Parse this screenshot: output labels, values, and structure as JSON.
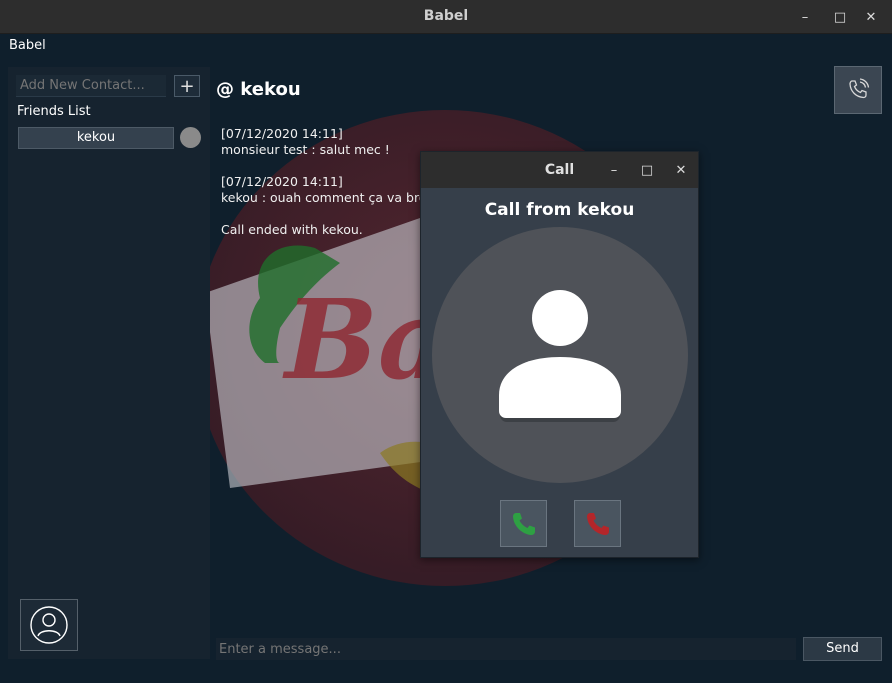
{
  "window": {
    "title": "Babel",
    "minimize_glyph": "–",
    "maximize_glyph": "□",
    "close_glyph": "✕"
  },
  "menubar": {
    "app_menu": "Babel"
  },
  "sidebar": {
    "add_contact_placeholder": "Add New Contact...",
    "add_button_label": "+",
    "friends_label": "Friends List",
    "friends": [
      {
        "name": "kekou",
        "status_color": "#8a8a8a"
      }
    ],
    "profile_icon": "user-circle-icon"
  },
  "chat": {
    "header": "@ kekou",
    "call_icon": "phone-ringing-icon",
    "messages": [
      {
        "timestamp": "[07/12/2020 14:11]",
        "text": "monsieur test : salut mec !"
      },
      {
        "timestamp": "[07/12/2020 14:11]",
        "text": "kekou : ouah comment ça va bro ?"
      }
    ],
    "status_message": "Call ended with kekou.",
    "input_placeholder": "Enter a message...",
    "send_label": "Send"
  },
  "call_dialog": {
    "title": "Call",
    "minimize_glyph": "–",
    "maximize_glyph": "□",
    "close_glyph": "✕",
    "heading": "Call from kekou",
    "avatar_icon": "user-silhouette-icon",
    "accept_icon": "phone-accept-icon",
    "decline_icon": "phone-decline-icon",
    "accept_color": "#2ea043",
    "decline_color": "#b3262a"
  },
  "colors": {
    "background": "#0f1f2c",
    "sidebar": "#16232f",
    "titlebar": "#2d2d2d",
    "dialog": "#363f4a"
  }
}
